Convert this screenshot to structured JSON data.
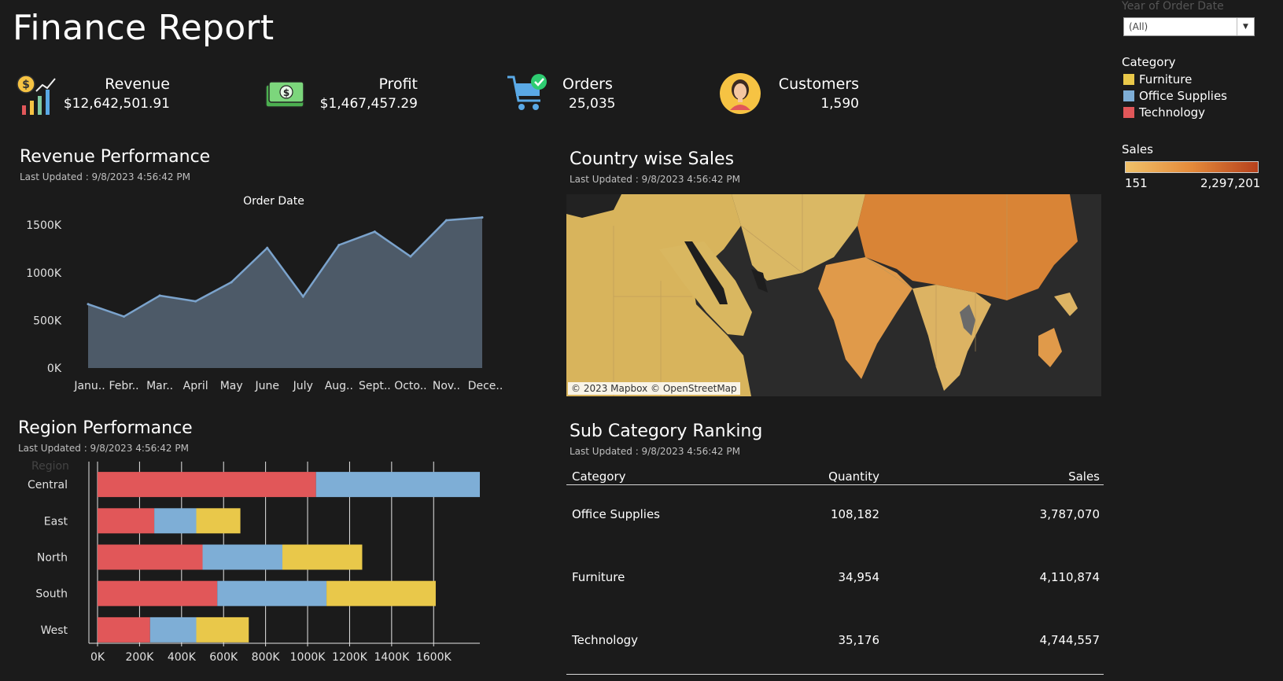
{
  "title": "Finance Report",
  "kpis": [
    {
      "label": "Revenue",
      "value": "$12,642,501.91",
      "icon": "revenue-chart-icon"
    },
    {
      "label": "Profit",
      "value": "$1,467,457.29",
      "icon": "cash-icon"
    },
    {
      "label": "Orders",
      "value": "25,035",
      "icon": "shopping-cart-icon"
    },
    {
      "label": "Customers",
      "value": "1,590",
      "icon": "customer-avatar-icon"
    }
  ],
  "filter": {
    "label": "Year of Order Date",
    "value": "(All)"
  },
  "category_legend": {
    "title": "Category",
    "items": [
      {
        "label": "Furniture",
        "color": "#e9c84a"
      },
      {
        "label": "Office Supplies",
        "color": "#7eaed6"
      },
      {
        "label": "Technology",
        "color": "#e15759"
      }
    ]
  },
  "sales_legend": {
    "title": "Sales",
    "min": "151",
    "max": "2,297,201",
    "color_low": "#f0c169",
    "color_high": "#b5401c"
  },
  "revenue_section": {
    "title": "Revenue Performance",
    "updated": "Last Updated : 9/8/2023 4:56:42 PM"
  },
  "map_section": {
    "title": "Country wise Sales",
    "updated": "Last Updated : 9/8/2023 4:56:42 PM",
    "credit": "© 2023 Mapbox © OpenStreetMap"
  },
  "region_section": {
    "title": "Region Performance",
    "updated": "Last Updated : 9/8/2023 4:56:42 PM"
  },
  "subcat_section": {
    "title": "Sub Category Ranking",
    "updated": "Last Updated : 9/8/2023 4:56:42 PM"
  },
  "subcat_table": {
    "headers": [
      "Category",
      "Quantity",
      "Sales"
    ],
    "rows": [
      {
        "category": "Office Supplies",
        "quantity": "108,182",
        "sales": "3,787,070"
      },
      {
        "category": "Furniture",
        "quantity": "34,954",
        "sales": "4,110,874"
      },
      {
        "category": "Technology",
        "quantity": "35,176",
        "sales": "4,744,557"
      }
    ]
  },
  "chart_data": [
    {
      "type": "area",
      "title": "Order Date",
      "categories": [
        "Janu..",
        "Febr..",
        "Mar..",
        "April",
        "May",
        "June",
        "July",
        "Aug..",
        "Sept..",
        "Octo..",
        "Nov..",
        "Dece.."
      ],
      "values": [
        670000,
        540000,
        760000,
        700000,
        900000,
        1260000,
        750000,
        1290000,
        1430000,
        1170000,
        1550000,
        1580000
      ],
      "yticks": [
        "0K",
        "500K",
        "1000K",
        "1500K"
      ],
      "ylim": [
        0,
        1650000
      ],
      "fill_color": "#4d5a68",
      "line_color": "#7ba3cc"
    },
    {
      "type": "bar",
      "orientation": "horizontal-stacked",
      "axis_title": "Region",
      "categories": [
        "Central",
        "East",
        "North",
        "South",
        "West"
      ],
      "series": [
        {
          "name": "Technology",
          "color": "#e15759",
          "values": [
            1040000,
            270000,
            500000,
            570000,
            250000
          ]
        },
        {
          "name": "Office Supplies",
          "color": "#7eaed6",
          "values": [
            780000,
            200000,
            380000,
            520000,
            220000
          ]
        },
        {
          "name": "Furniture",
          "color": "#e9c84a",
          "values": [
            0,
            210000,
            380000,
            520000,
            250000
          ]
        }
      ],
      "xticks": [
        "0K",
        "200K",
        "400K",
        "600K",
        "800K",
        "1000K",
        "1200K",
        "1400K",
        "1600K"
      ],
      "xlim": [
        0,
        1820000
      ]
    }
  ]
}
